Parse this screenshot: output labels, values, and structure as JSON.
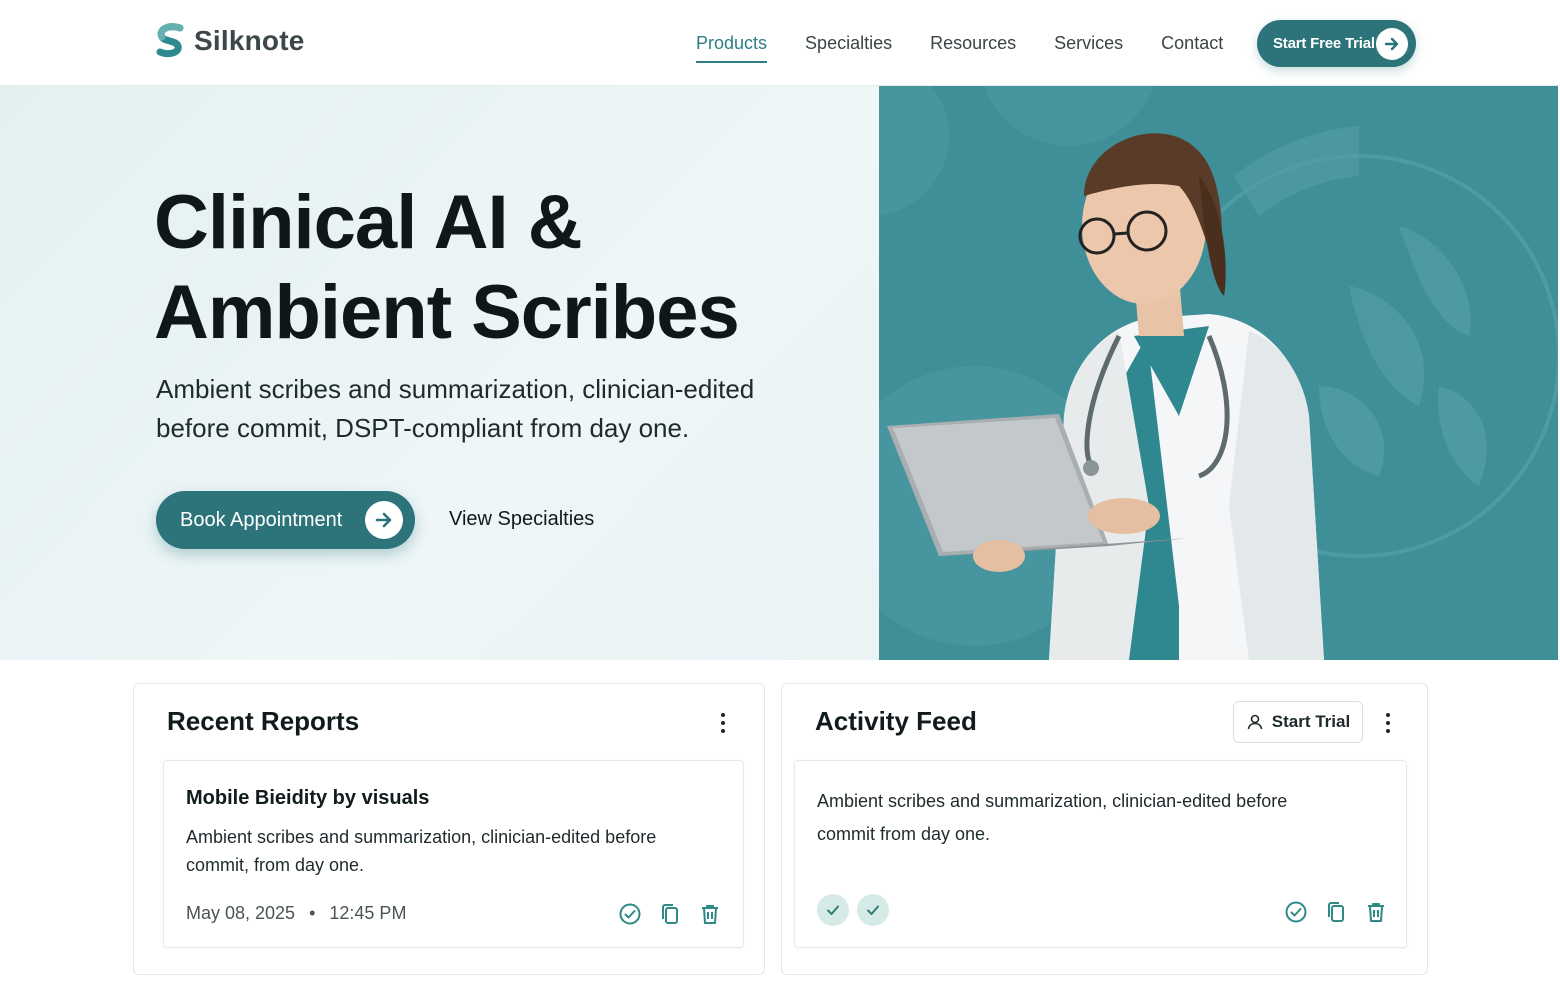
{
  "brand": {
    "name": "Silknote",
    "accent": "#2c7479",
    "accent_light": "#2d7f86"
  },
  "nav": {
    "items": [
      {
        "label": "Products",
        "active": true
      },
      {
        "label": "Specialties",
        "active": false
      },
      {
        "label": "Resources",
        "active": false
      },
      {
        "label": "Services",
        "active": false
      },
      {
        "label": "Contact",
        "active": false
      }
    ],
    "cta_label": "Start Free Trial",
    "cta_icon": "arrow-right-icon"
  },
  "hero": {
    "title_line1": "Clinical AI &",
    "title_line2": "Ambient Scribes",
    "subtitle": "Ambient scribes and summarization, clinician-edited before commit, DSPT-compliant from day one.",
    "primary_label": "Book Appointment",
    "secondary_label": "View Specialties",
    "image": "doctor-with-laptop"
  },
  "reports": {
    "title": "Recent Reports",
    "item": {
      "title": "Mobile Bieidity by visuals",
      "body": "Ambient scribes and summarization, clinician-edited before commit, from day one.",
      "date": "May 08, 2025",
      "separator": "•",
      "time": "12:45 PM"
    },
    "actions": [
      "check-circle-icon",
      "copy-icon",
      "trash-icon"
    ]
  },
  "activity": {
    "title": "Activity Feed",
    "trial_label": "Start Trial",
    "item": {
      "body": "Ambient scribes and summarization, clinician-edited before commit from day one."
    },
    "actions": [
      "check-circle-icon",
      "copy-icon",
      "trash-icon"
    ]
  }
}
